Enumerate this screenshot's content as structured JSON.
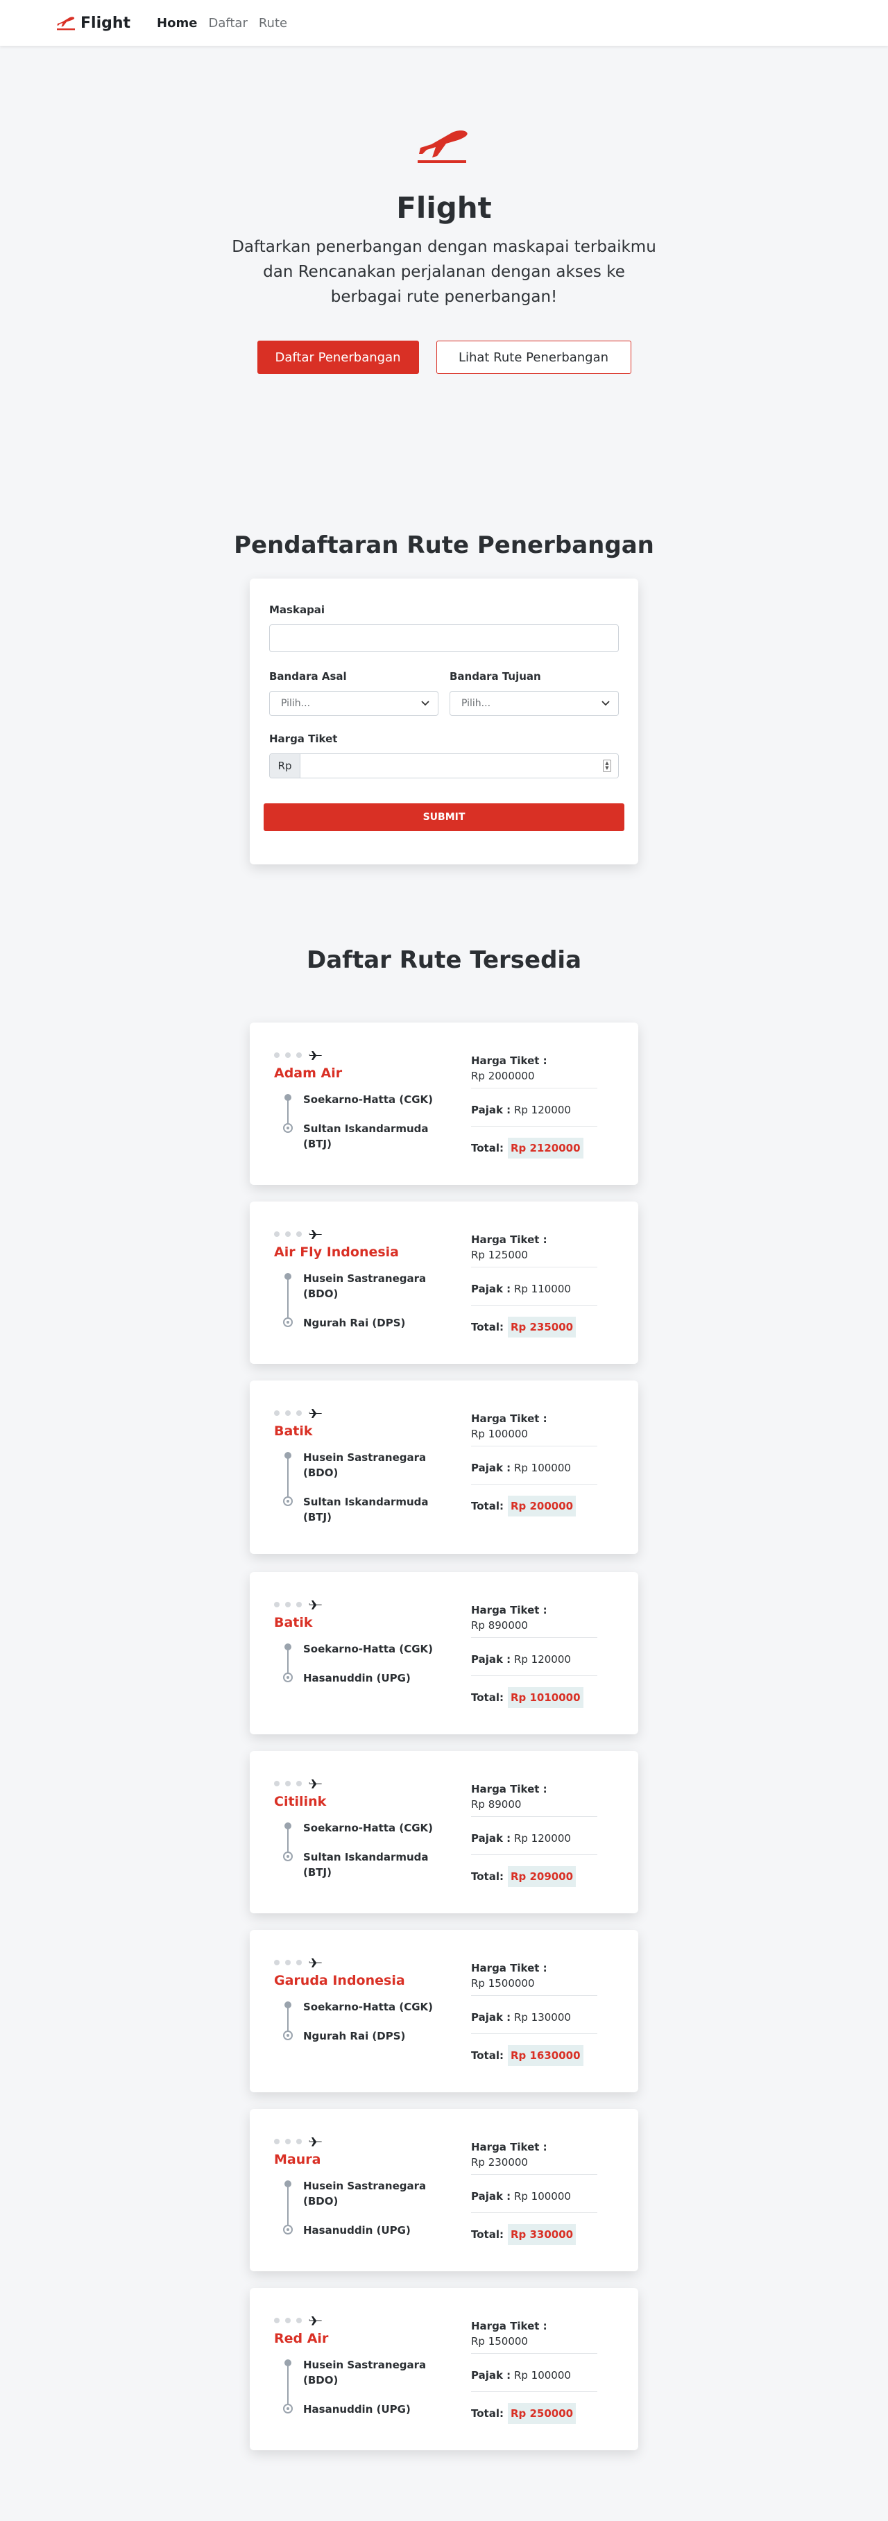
{
  "nav": {
    "brand": "Flight",
    "links": [
      "Home",
      "Daftar",
      "Rute"
    ]
  },
  "hero": {
    "title": "Flight",
    "subtitle": "Daftarkan penerbangan dengan maskapai terbaikmu dan Rencanakan perjalanan dengan akses ke berbagai rute penerbangan!",
    "primary_button": "Daftar Penerbangan",
    "secondary_button": "Lihat Rute Penerbangan"
  },
  "form": {
    "title": "Pendaftaran Rute Penerbangan",
    "airline_label": "Maskapai",
    "airline_value": "",
    "origin_label": "Bandara Asal",
    "origin_selected": "Pilih...",
    "dest_label": "Bandara Tujuan",
    "dest_selected": "Pilih...",
    "price_label": "Harga Tiket",
    "price_prefix": "Rp",
    "price_value": "",
    "submit_label": "SUBMIT"
  },
  "routes_section": {
    "title": "Daftar Rute Tersedia",
    "price_label": "Harga Tiket :",
    "tax_label": "Pajak :",
    "total_label": "Total:"
  },
  "routes": [
    {
      "airline": "Adam Air",
      "from": "Soekarno-Hatta (CGK)",
      "to": "Sultan Iskandarmuda (BTJ)",
      "price": "Rp 2000000",
      "tax": "Rp 120000",
      "total": "Rp 2120000"
    },
    {
      "airline": "Air Fly Indonesia",
      "from": "Husein Sastranegara (BDO)",
      "to": "Ngurah Rai (DPS)",
      "price": "Rp 125000",
      "tax": "Rp 110000",
      "total": "Rp 235000"
    },
    {
      "airline": "Batik",
      "from": "Husein Sastranegara (BDO)",
      "to": "Sultan Iskandarmuda (BTJ)",
      "price": "Rp 100000",
      "tax": "Rp 100000",
      "total": "Rp 200000"
    },
    {
      "airline": "Batik",
      "from": "Soekarno-Hatta (CGK)",
      "to": "Hasanuddin (UPG)",
      "price": "Rp 890000",
      "tax": "Rp 120000",
      "total": "Rp 1010000"
    },
    {
      "airline": "Citilink",
      "from": "Soekarno-Hatta (CGK)",
      "to": "Sultan Iskandarmuda (BTJ)",
      "price": "Rp 89000",
      "tax": "Rp 120000",
      "total": "Rp 209000"
    },
    {
      "airline": "Garuda Indonesia",
      "from": "Soekarno-Hatta (CGK)",
      "to": "Ngurah Rai (DPS)",
      "price": "Rp 1500000",
      "tax": "Rp 130000",
      "total": "Rp 1630000"
    },
    {
      "airline": "Maura",
      "from": "Husein Sastranegara (BDO)",
      "to": "Hasanuddin (UPG)",
      "price": "Rp 230000",
      "tax": "Rp 100000",
      "total": "Rp 330000"
    },
    {
      "airline": "Red Air",
      "from": "Husein Sastranegara (BDO)",
      "to": "Hasanuddin (UPG)",
      "price": "Rp 150000",
      "tax": "Rp 100000",
      "total": "Rp 250000"
    }
  ],
  "colors": {
    "accent": "#d93025",
    "background": "#f5f6f8",
    "total_badge": "#e4eff0"
  },
  "icons": {
    "brand": "plane-takeoff-icon",
    "route": "plane-icon"
  }
}
